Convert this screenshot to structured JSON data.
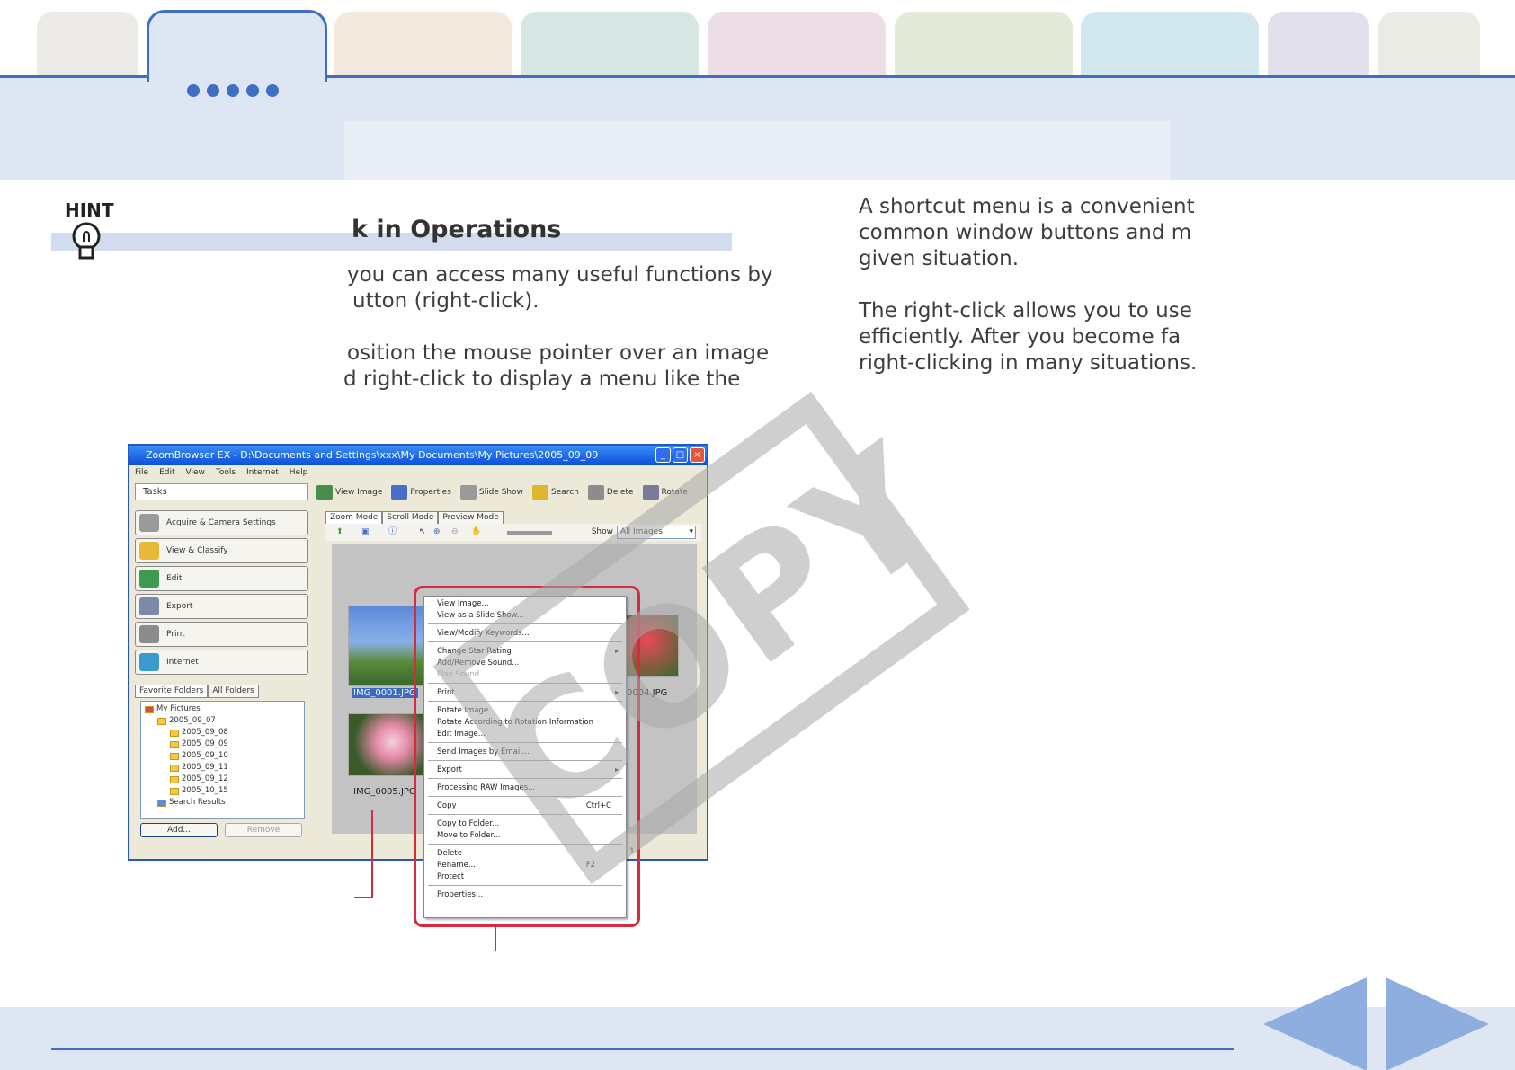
{
  "tabs": [
    {
      "color": "#eceae6"
    },
    {
      "color": "#dfe6f3",
      "active": true
    },
    {
      "color": "#f3e8dc"
    },
    {
      "color": "#d6e6e2"
    },
    {
      "color": "#eddde6"
    },
    {
      "color": "#e4ead8"
    },
    {
      "color": "#d3e7ee"
    },
    {
      "color": "#e1e0ec"
    },
    {
      "color": "#ebebe6"
    }
  ],
  "hint": {
    "label": "HINT",
    "heading": "k in Operations"
  },
  "left_text": {
    "line1": "you can access many useful functions by",
    "line2": "utton (right-click).",
    "line3": "osition the mouse pointer over an image",
    "line4": "d right-click to display a menu like the"
  },
  "right_text": {
    "line1": "A shortcut menu is a convenient",
    "line2": "common window buttons and m",
    "line3": "given situation.",
    "line4": "The right-click allows you to use",
    "line5": "efficiently. After you become fa",
    "line6": "right-clicking in many situations."
  },
  "app": {
    "title": "ZoomBrowser EX  -  D:\\Documents and Settings\\xxx\\My Documents\\My Pictures\\2005_09_09",
    "menu": [
      "File",
      "Edit",
      "View",
      "Tools",
      "Internet",
      "Help"
    ],
    "tasks_label": "Tasks",
    "task_buttons": [
      "Acquire & Camera Settings",
      "View & Classify",
      "Edit",
      "Export",
      "Print",
      "Internet"
    ],
    "folder_tabs": [
      "Favorite Folders",
      "All Folders"
    ],
    "tree": [
      "My Pictures",
      "2005_09_07",
      "2005_09_08",
      "2005_09_09",
      "2005_09_10",
      "2005_09_11",
      "2005_09_12",
      "2005_10_15",
      "Search Results"
    ],
    "add_label": "Add...",
    "remove_label": "Remove",
    "toolbar": [
      "View Image",
      "Properties",
      "Slide Show",
      "Search",
      "Delete",
      "Rotate"
    ],
    "mode_tabs": [
      "Zoom Mode",
      "Scroll Mode",
      "Preview Mode"
    ],
    "show_label": "Show",
    "show_value": "All Images",
    "thumbs": [
      "IMG_0001.JPG",
      "0004.JPG",
      "IMG_0005.JPG"
    ],
    "status_page": "1"
  },
  "context_menu": [
    "View Image...",
    "View as a Slide Show...",
    "View/Modify Keywords...",
    "Change Star Rating",
    "Add/Remove Sound...",
    "Play Sound...",
    "Print",
    "Rotate Image...",
    "Rotate According to Rotation Information",
    "Edit Image...",
    "Send Images by Email...",
    "Export",
    "Processing RAW Images...",
    "Copy",
    "Copy to Folder...",
    "Move to Folder...",
    "Delete",
    "Rename...",
    "Protect",
    "Properties..."
  ],
  "context_keys": {
    "copy": "Ctrl+C",
    "rename": "F2"
  },
  "watermark": "COPY",
  "accent_color": "#3f6fc2",
  "highlight_color": "#d62b3f"
}
